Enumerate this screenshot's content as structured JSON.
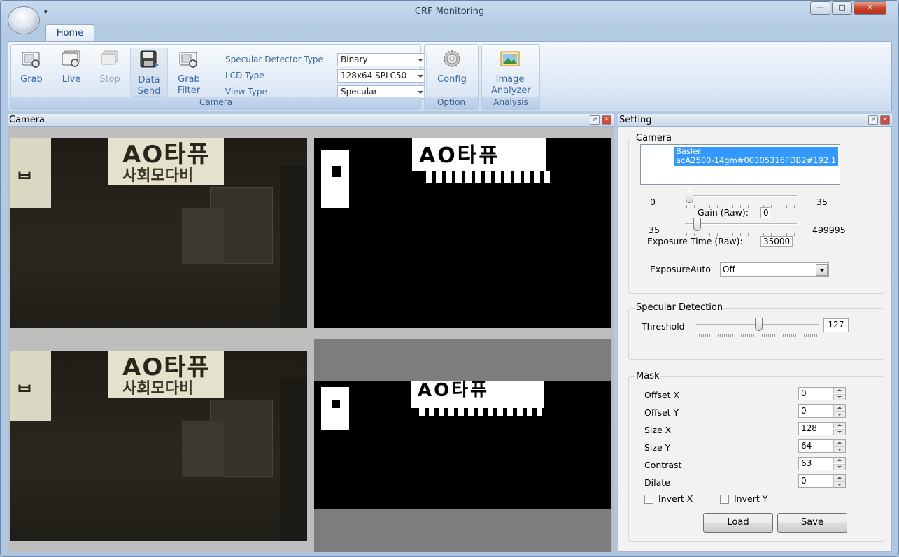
{
  "window": {
    "title": "CRF Monitoring",
    "qat_glyph": "▾",
    "minimize": "—",
    "maximize": "□",
    "close": "✕"
  },
  "ribbon": {
    "tab_home": "Home",
    "buttons": {
      "grab": "Grab",
      "live": "Live",
      "stop": "Stop",
      "data_send_1": "Data",
      "data_send_2": "Send",
      "grab_filter_1": "Grab",
      "grab_filter_2": "Filter",
      "config": "Config",
      "image_analyzer_1": "Image",
      "image_analyzer_2": "Analyzer"
    },
    "specular_detector_type_label": "Specular Detector Type",
    "specular_detector_type_value": "Binary",
    "lcd_type_label": "LCD Type",
    "lcd_type_value": "128x64 SPLC50",
    "view_type_label": "View Type",
    "view_type_value": "Specular",
    "groups": {
      "camera": "Camera",
      "option": "Option",
      "analysis": "Analysis"
    }
  },
  "camera_pane": {
    "title": "Camera",
    "restore": "⇗",
    "close": "✕"
  },
  "setting_pane": {
    "title": "Setting",
    "restore": "⇗",
    "close": "✕",
    "camera": {
      "group": "Camera",
      "device_line1": "Basler",
      "device_line2": "acA2500-14gm#00305316FDB2#192.1",
      "gain_min": "0",
      "gain_max": "35",
      "gain_label": "Gain (Raw):",
      "gain_value": "0",
      "gain_fraction": 0.0,
      "exp_min": "35",
      "exp_max": "499995",
      "exp_label": "Exposure Time (Raw):",
      "exp_value": "35000",
      "exp_fraction": 0.07,
      "exposure_auto_label": "ExposureAuto",
      "exposure_auto_value": "Off"
    },
    "specular": {
      "group": "Specular Detection",
      "threshold_label": "Threshold",
      "threshold_value": "127",
      "threshold_fraction": 0.5
    },
    "mask": {
      "group": "Mask",
      "offset_x_label": "Offset X",
      "offset_x": "0",
      "offset_y_label": "Offset Y",
      "offset_y": "0",
      "size_x_label": "Size X",
      "size_x": "128",
      "size_y_label": "Size Y",
      "size_y": "64",
      "contrast_label": "Contrast",
      "contrast": "63",
      "dilate_label": "Dilate",
      "dilate": "0",
      "invert_x_label": "Invert X",
      "invert_x": false,
      "invert_y_label": "Invert Y",
      "invert_y": false,
      "load": "Load",
      "save": "Save"
    }
  },
  "camera_views": {
    "sign_text_1": "AO타퓨",
    "sign_text_2": "ᄇ",
    "sign_text_3": "사회모다비"
  }
}
